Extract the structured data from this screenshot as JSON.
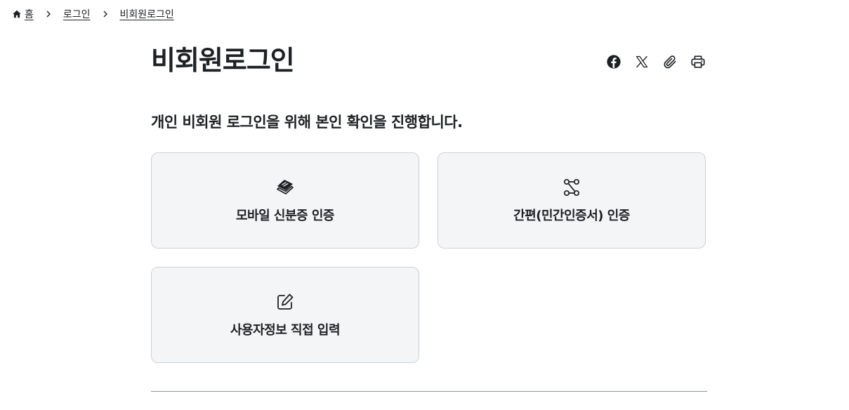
{
  "breadcrumb": {
    "items": [
      {
        "label": "홈",
        "icon": "home-icon"
      },
      {
        "label": "로그인"
      },
      {
        "label": "비회원로그인"
      }
    ]
  },
  "page": {
    "title": "비회원로그인",
    "subtitle": "개인 비회원 로그인을 위해 본인 확인을 진행합니다."
  },
  "share_tools": [
    "facebook-icon",
    "x-icon",
    "paperclip-icon",
    "print-icon"
  ],
  "auth_options": [
    {
      "label": "모바일 신분증 인증",
      "icon": "mobile-id-icon"
    },
    {
      "label": "간편(민간인증서) 인증",
      "icon": "simple-auth-icon"
    },
    {
      "label": "사용자정보 직접 입력",
      "icon": "edit-icon"
    }
  ],
  "colors": {
    "text": "#1e2124",
    "card_bg": "#f4f5f6",
    "card_border": "#cdd1d5",
    "divider": "#8a949e"
  }
}
